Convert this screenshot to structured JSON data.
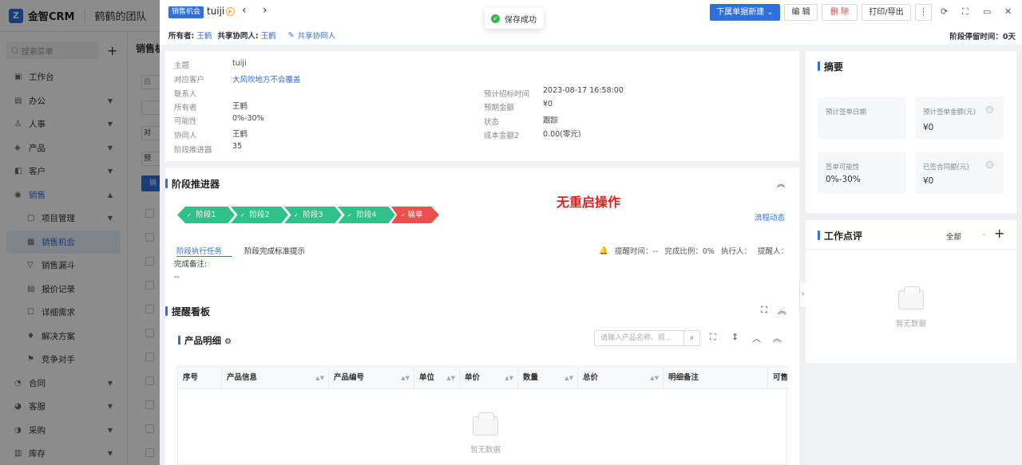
{
  "app": {
    "logo_letter": "Z",
    "name": "金智CRM",
    "team": "鹤鹤的团队"
  },
  "sidebar": {
    "search_placeholder": "搜索菜单",
    "items": [
      {
        "label": "工作台",
        "icon": "dashboard-icon"
      },
      {
        "label": "办公",
        "icon": "office-icon"
      },
      {
        "label": "人事",
        "icon": "person-icon"
      },
      {
        "label": "产品",
        "icon": "product-icon"
      },
      {
        "label": "客户",
        "icon": "customer-icon"
      },
      {
        "label": "销售",
        "icon": "sales-icon"
      },
      {
        "label": "项目管理",
        "icon": "project-icon"
      },
      {
        "label": "销售机会",
        "icon": "opportunity-icon"
      },
      {
        "label": "销售漏斗",
        "icon": "funnel-icon"
      },
      {
        "label": "报价记录",
        "icon": "quote-icon"
      },
      {
        "label": "详细需求",
        "icon": "requirement-icon"
      },
      {
        "label": "解决方案",
        "icon": "solution-icon"
      },
      {
        "label": "竞争对手",
        "icon": "competitor-icon"
      },
      {
        "label": "合同",
        "icon": "contract-icon"
      },
      {
        "label": "客服",
        "icon": "service-icon"
      },
      {
        "label": "采购",
        "icon": "purchase-icon"
      },
      {
        "label": "库存",
        "icon": "inventory-icon"
      }
    ]
  },
  "list_bg": {
    "title": "销售机",
    "chip_texts": [
      "自",
      "",
      "对",
      "预"
    ],
    "button": "销"
  },
  "header": {
    "badge": "销售机会",
    "record_name": "tuiji",
    "prev": "‹",
    "next": "›",
    "toast": "保存成功",
    "new_sub_button": "下属单据新建 ⌄",
    "edit_button": "编 辑",
    "delete_button": "删 除",
    "print_button": "打印/导出",
    "owner_label": "所有者:",
    "owner": "王鹤",
    "shared_label": "共享协同人:",
    "shared": "王鹤",
    "share_link": "共享协同人",
    "stage_stay": "阶段停留时间：0天"
  },
  "info": {
    "left": [
      {
        "label": "主题",
        "value": "tuiji",
        "link": false
      },
      {
        "label": "对应客户",
        "value": "大风吹地方不会覆盖",
        "link": true
      },
      {
        "label": "联系人",
        "value": "",
        "link": false
      },
      {
        "label": "所有者",
        "value": "王鹤",
        "link": false
      },
      {
        "label": "可能性",
        "value": "0%-30%",
        "link": false
      },
      {
        "label": "协同人",
        "value": "王鹤",
        "link": false
      },
      {
        "label": "阶段推进器",
        "value": "35",
        "link": false
      }
    ],
    "right": [
      {
        "label": "预计招标时间",
        "value": "2023-08-17 16:58:00"
      },
      {
        "label": "预期金额",
        "value": "¥0"
      },
      {
        "label": "状态",
        "value": "跟踪"
      },
      {
        "label": "成本金额2",
        "value": "0.00(零元)"
      }
    ]
  },
  "stage": {
    "title": "阶段推进器",
    "stages": [
      "阶段1",
      "阶段2",
      "阶段3",
      "阶段4"
    ],
    "lose": "输单",
    "annotation": "无重启操作",
    "flow_link": "流程动态",
    "task_tab": "阶段执行任务",
    "std_tip": "阶段完成标准提示",
    "remind_time": "提醒时间：--",
    "done_ratio": "完成比例：0%",
    "executor": "执行人：",
    "reminder": "提醒人：",
    "note_label": "完成备注:",
    "note_value": "--"
  },
  "board": {
    "title": "提醒看板",
    "product_title": "产品明细",
    "search_placeholder": "请输入产品名称、规...",
    "columns": [
      "序号",
      "产品信息",
      "产品编号",
      "单位",
      "单价",
      "数量",
      "总价",
      "明细备注",
      "可售"
    ],
    "empty": "暂无数据"
  },
  "summary": {
    "title": "摘要",
    "stats": [
      {
        "label": "预计签单日期",
        "value": ""
      },
      {
        "label": "预计签单金额(元)",
        "value": "¥0"
      },
      {
        "label": "签单可能性",
        "value": "0%-30%"
      },
      {
        "label": "已签合同额(元)",
        "value": "¥0"
      }
    ]
  },
  "review": {
    "title": "工作点评",
    "filter": "全部",
    "empty": "暂无数据"
  }
}
